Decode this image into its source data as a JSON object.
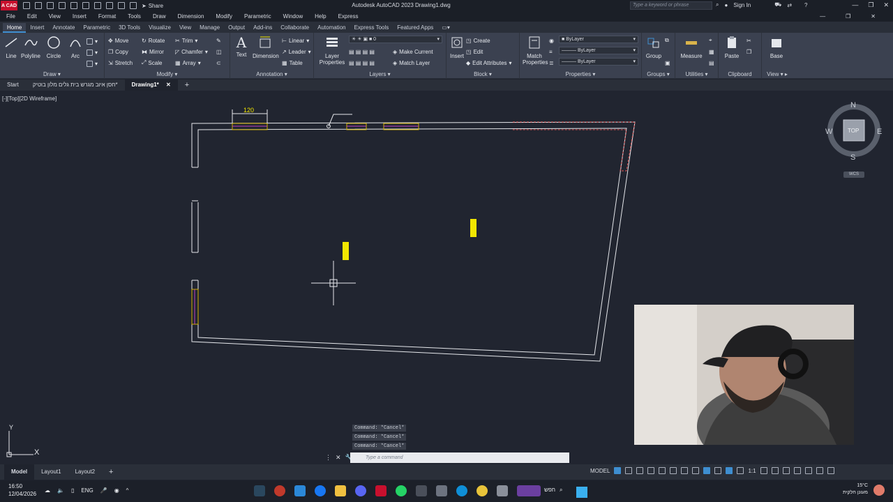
{
  "titlebar": {
    "app_badge": "A CAD",
    "title": "Autodesk AutoCAD 2023  Drawing1.dwg",
    "share": "Share",
    "search_placeholder": "Type a keyword or phrase",
    "sign_in": "Sign In"
  },
  "menu": [
    "File",
    "Edit",
    "View",
    "Insert",
    "Format",
    "Tools",
    "Draw",
    "Dimension",
    "Modify",
    "Parametric",
    "Window",
    "Help",
    "Express"
  ],
  "ribbon_tabs": [
    "Home",
    "Insert",
    "Annotate",
    "Parametric",
    "3D Tools",
    "Visualize",
    "View",
    "Manage",
    "Output",
    "Add-ins",
    "Collaborate",
    "Automation",
    "Express Tools",
    "Featured Apps"
  ],
  "ribbon": {
    "draw": {
      "title": "Draw",
      "line": "Line",
      "polyline": "Polyline",
      "circle": "Circle",
      "arc": "Arc"
    },
    "modify": {
      "title": "Modify",
      "move": "Move",
      "rotate": "Rotate",
      "trim": "Trim",
      "copy": "Copy",
      "mirror": "Mirror",
      "chamfer": "Chamfer",
      "stretch": "Stretch",
      "scale": "Scale",
      "array": "Array"
    },
    "annotation": {
      "title": "Annotation",
      "text": "Text",
      "dimension": "Dimension",
      "linear": "Linear",
      "leader": "Leader",
      "table": "Table"
    },
    "layers": {
      "title": "Layers",
      "layer_properties": "Layer Properties",
      "layer_value": "0",
      "make_current": "Make Current",
      "match_layer": "Match Layer"
    },
    "block": {
      "title": "Block",
      "insert": "Insert",
      "create": "Create",
      "edit": "Edit",
      "edit_attributes": "Edit Attributes"
    },
    "properties": {
      "title": "Properties",
      "match_properties": "Match Properties",
      "color": "ByLayer",
      "linetype": "ByLayer",
      "lineweight": "ByLayer"
    },
    "groups": {
      "title": "Groups",
      "group": "Group"
    },
    "utilities": {
      "title": "Utilities",
      "measure": "Measure"
    },
    "clipboard": {
      "title": "Clipboard",
      "paste": "Paste"
    },
    "view": {
      "title": "View",
      "base": "Base"
    }
  },
  "file_tabs": {
    "start": "Start",
    "doc1": "חסן איוב מגרש בית גלים מלון בוטיק*",
    "doc2": "Drawing1*"
  },
  "viewport": {
    "label": "[-][Top][2D Wireframe]",
    "dimension_text": "120",
    "compass": {
      "n": "N",
      "s": "S",
      "e": "E",
      "w": "W",
      "top": "TOP",
      "wcs": "WCS"
    },
    "ucs_y": "Y",
    "ucs_x": "X"
  },
  "command": {
    "history": [
      "Command: *Cancel*",
      "Command: *Cancel*",
      "Command: *Cancel*"
    ],
    "placeholder": "Type a command"
  },
  "layout_tabs": [
    "Model",
    "Layout1",
    "Layout2"
  ],
  "status": {
    "model": "MODEL",
    "scale": "1:1"
  },
  "taskbar": {
    "time": "16:50",
    "date": "12/04/2026",
    "lang": "ENG",
    "search": "חפש",
    "weather_temp": "15°C",
    "weather_desc": "מעונן חלקית"
  },
  "colors": {
    "accent": "#3e8ed0",
    "canvas": "#212530",
    "yellow": "#f2e600",
    "magenta": "#c040c0"
  }
}
